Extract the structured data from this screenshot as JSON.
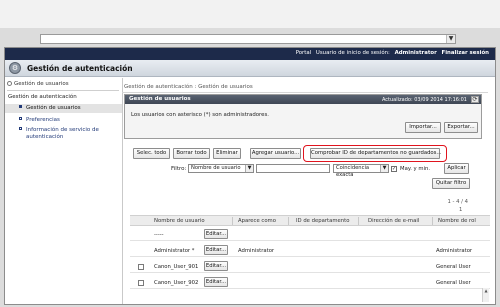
{
  "nav": {
    "links": [
      "Portal",
      "Usuario de inicio de sesión:",
      "Administrator",
      "Finalizar sesión"
    ]
  },
  "app": {
    "title": "Gestión de autenticación"
  },
  "sidebar": {
    "top_link": "Gestión de usuarios",
    "section": "Gestión de autenticación",
    "items": [
      {
        "label": "Gestión de usuarios"
      },
      {
        "label": "Preferencias"
      },
      {
        "label": "Información de servicio de autenticación"
      }
    ]
  },
  "breadcrumb": "Gestión de autenticación : Gestión de usuarios",
  "panel": {
    "title": "Gestión de usuarios",
    "updated": "Actualizado: 03/09 2014 17:16:01",
    "note": "Los usuarios con asterisco (*) son administradores.",
    "import_label": "Importar...",
    "export_label": "Exportar..."
  },
  "toolbar": {
    "select_all": "Selec. todo",
    "clear_all": "Borrar todo",
    "delete": "Eliminar",
    "add_user": "Agregar usuario...",
    "check_dept": "Comprobar ID de departamentos no guardados..."
  },
  "filter": {
    "label": "Filtro:",
    "field": "Nombre de usuario",
    "value": "",
    "match": "Coincidencia exacta",
    "case_label": "May. y min.",
    "case_checked": "✓",
    "apply": "Aplicar",
    "clear": "Quitar filtro"
  },
  "pagination": {
    "count": "1 - 4 / 4",
    "page": "1"
  },
  "table": {
    "headers": [
      "Nombre de usuario",
      "Aparece como",
      "ID de departamento",
      "Dirección de e-mail",
      "Nombre de rol"
    ],
    "edit_label": "Editar...",
    "rows": [
      {
        "name": "-----",
        "display": "",
        "role": ""
      },
      {
        "name": "Administrator *",
        "display": "Administrator",
        "role": "Administrator"
      },
      {
        "name": "Canon_User_901",
        "display": "",
        "role": "General User"
      },
      {
        "name": "Canon_User_902",
        "display": "",
        "role": "General User"
      }
    ]
  },
  "icons": {
    "app": "gear-icon",
    "refresh": "refresh-icon",
    "dropdown": "chevron-down-icon"
  },
  "colors": {
    "nav_bg": "#1d2a4a",
    "highlight": "#e0141e",
    "link": "#223a78"
  }
}
